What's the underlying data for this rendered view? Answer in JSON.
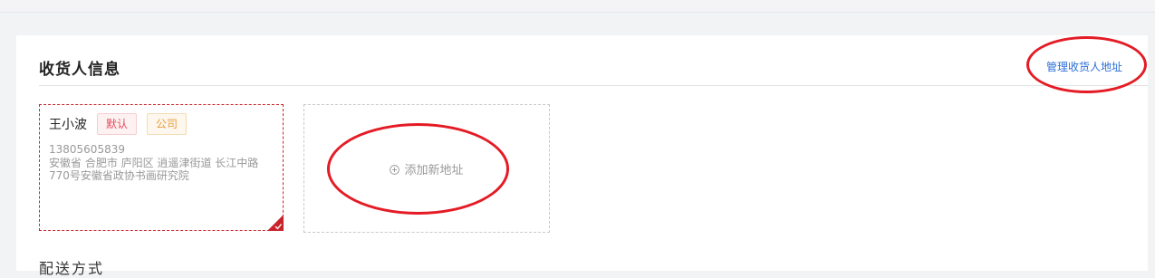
{
  "section": {
    "title": "收货人信息",
    "manage_link": "管理收货人地址"
  },
  "address_card": {
    "name": "王小波",
    "tags": [
      "默认",
      "公司"
    ],
    "phone": "13805605839",
    "address": "安徽省 合肥市 庐阳区 逍遥津街道 长江中路770号安徽省政协书画研究院",
    "selected": true
  },
  "add_address": {
    "label": "添加新地址",
    "icon": "plus-circle-icon"
  },
  "next_section": {
    "title": "配送方式"
  },
  "colors": {
    "accent": "#c8232b",
    "link": "#2c6ed5",
    "annotation": "#e41b25"
  }
}
